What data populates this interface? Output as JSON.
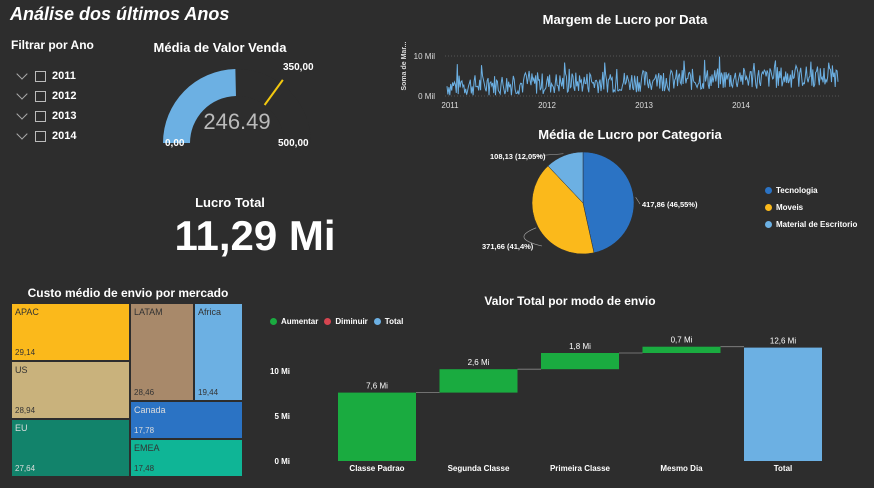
{
  "page_title": "Análise dos últimos Anos",
  "filter": {
    "title": "Filtrar por Ano",
    "years": [
      "2011",
      "2012",
      "2013",
      "2014"
    ]
  },
  "gauge": {
    "title": "Média de Valor Venda",
    "value": 246.49,
    "value_label": "246.49",
    "min_label": "0,00",
    "max_label": "500,00",
    "target_label": "350,00",
    "min": 0,
    "max": 500,
    "target": 350,
    "fill_color": "#6cb0e3",
    "target_color": "#f2c80f"
  },
  "kpi": {
    "title": "Lucro Total",
    "value": "11,29 Mi"
  },
  "line_chart": {
    "title": "Margem de Lucro por Data",
    "ylabel": "Soma de Mar...",
    "y_ticks": [
      "10 Mil",
      "0 Mil"
    ],
    "x_ticks": [
      "2011",
      "2012",
      "2013",
      "2014"
    ],
    "color": "#6cb0e3"
  },
  "pie_chart": {
    "title": "Média de Lucro por Categoria",
    "slices": [
      {
        "name": "Tecnologia",
        "value": 417.86,
        "label": "417,86 (46,55%)",
        "color": "#2b73c4"
      },
      {
        "name": "Moveis",
        "value": 371.66,
        "label": "371,66 (41,4%)",
        "color": "#fbb91b"
      },
      {
        "name": "Material de Escritorio",
        "value": 108.13,
        "label": "108,13 (12,05%)",
        "color": "#6cb0e3"
      }
    ]
  },
  "treemap": {
    "title": "Custo médio de envio por mercado",
    "cells": [
      {
        "name": "APAC",
        "value": "29,14",
        "color": "#fbb91b"
      },
      {
        "name": "US",
        "value": "28,94",
        "color": "#c9b27c"
      },
      {
        "name": "EU",
        "value": "27,64",
        "color": "#12836b"
      },
      {
        "name": "LATAM",
        "value": "28,46",
        "color": "#a8896a"
      },
      {
        "name": "Africa",
        "value": "19,44",
        "color": "#6cb0e3"
      },
      {
        "name": "Canada",
        "value": "17,78",
        "color": "#2b73c4"
      },
      {
        "name": "EMEA",
        "value": "17,48",
        "color": "#0fb596"
      }
    ]
  },
  "waterfall": {
    "title": "Valor Total por modo de envio",
    "legend": [
      {
        "name": "Aumentar",
        "color": "#1aab40"
      },
      {
        "name": "Diminuir",
        "color": "#d64550"
      },
      {
        "name": "Total",
        "color": "#6cb0e3"
      }
    ],
    "y_ticks": [
      "10 Mi",
      "5 Mi",
      "0 Mi"
    ]
  },
  "chart_data": [
    {
      "type": "gauge",
      "title": "Média de Valor Venda",
      "value": 246.49,
      "min": 0,
      "max": 500,
      "target": 350
    },
    {
      "type": "line",
      "title": "Margem de Lucro por Data",
      "ylabel": "Soma de Mar...",
      "x_range": [
        "2011",
        "2014"
      ],
      "ylim": [
        0,
        10000
      ],
      "note_values": "daily series oscillating mostly between ~1k and ~8k, slightly increasing over time"
    },
    {
      "type": "pie",
      "title": "Média de Lucro por Categoria",
      "categories": [
        "Tecnologia",
        "Moveis",
        "Material de Escritorio"
      ],
      "values": [
        417.86,
        371.66,
        108.13
      ],
      "percent": [
        46.55,
        41.4,
        12.05
      ],
      "legend": "right"
    },
    {
      "type": "treemap",
      "title": "Custo médio de envio por mercado",
      "categories": [
        "APAC",
        "US",
        "EU",
        "LATAM",
        "Africa",
        "Canada",
        "EMEA"
      ],
      "values": [
        29.14,
        28.94,
        27.64,
        28.46,
        19.44,
        17.78,
        17.48
      ]
    },
    {
      "type": "bar",
      "subtype": "waterfall",
      "title": "Valor Total por modo de envio",
      "categories": [
        "Classe Padrao",
        "Segunda Classe",
        "Primeira Classe",
        "Mesmo Dia",
        "Total"
      ],
      "values": [
        7.6,
        2.6,
        1.8,
        0.7,
        12.6
      ],
      "value_labels": [
        "7,6 Mi",
        "2,6 Mi",
        "1,8 Mi",
        "0,7 Mi",
        "12,6 Mi"
      ],
      "ylim": [
        0,
        13
      ],
      "legend": "top-left"
    }
  ]
}
